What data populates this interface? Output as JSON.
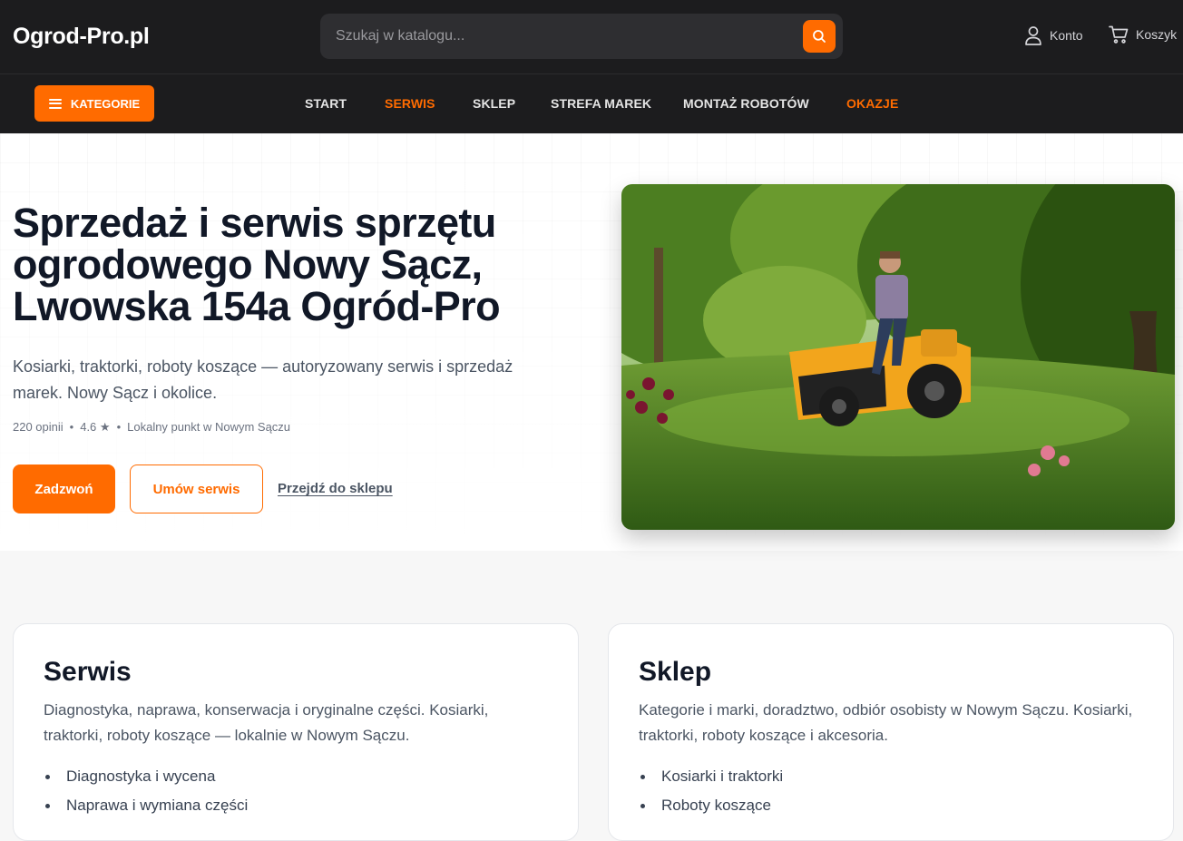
{
  "header": {
    "logo": "Ogrod-Pro.pl",
    "search": {
      "placeholder": "Szukaj w katalogu...",
      "value": ""
    },
    "account_label": "Konto",
    "cart_label": "Koszyk"
  },
  "nav": {
    "categories_label": "KATEGORIE",
    "items": [
      {
        "label": "START",
        "accent": false
      },
      {
        "label": "SERWIS",
        "accent": true
      },
      {
        "label": "SKLEP",
        "accent": false
      },
      {
        "label": "STREFA MAREK",
        "accent": false
      },
      {
        "label": "MONTAŻ ROBOTÓW",
        "accent": false
      },
      {
        "label": "OKAZJE",
        "accent": true
      }
    ]
  },
  "hero": {
    "title": "Sprzedaż i serwis sprzętu ogrodowego Nowy Sącz, Lwowska 154a Ogród-Pro",
    "lead": "Kosiarki, traktorki, roboty koszące — autoryzowany serwis i sprzedaż marek. Nowy Sącz i okolice.",
    "reviews": "220 opinii",
    "rating": "4.6 ★",
    "location": "Lokalny punkt w Nowym Sączu",
    "separator": "•",
    "btn_call": "Zadzwoń",
    "btn_service": "Umów serwis",
    "link_shop": "Przejdź do sklepu"
  },
  "cards": [
    {
      "title": "Serwis",
      "text": "Diagnostyka, naprawa, konserwacja i oryginalne części. Kosiarki, traktorki, roboty koszące — lokalnie w Nowym Sączu.",
      "items": [
        "Diagnostyka i wycena",
        "Naprawa i wymiana części"
      ]
    },
    {
      "title": "Sklep",
      "text": "Kategorie i marki, doradztwo, odbiór osobisty w Nowym Sączu. Kosiarki, traktorki, roboty koszące i akcesoria.",
      "items": [
        "Kosiarki i traktorki",
        "Roboty koszące"
      ]
    }
  ],
  "colors": {
    "accent": "#ff6b00",
    "header_bg": "#1c1c1e",
    "text_dark": "#111827",
    "text_muted": "#4b5563"
  },
  "icons": {
    "search": "search-icon",
    "account": "user-icon",
    "cart": "cart-icon",
    "menu": "menu-icon"
  }
}
